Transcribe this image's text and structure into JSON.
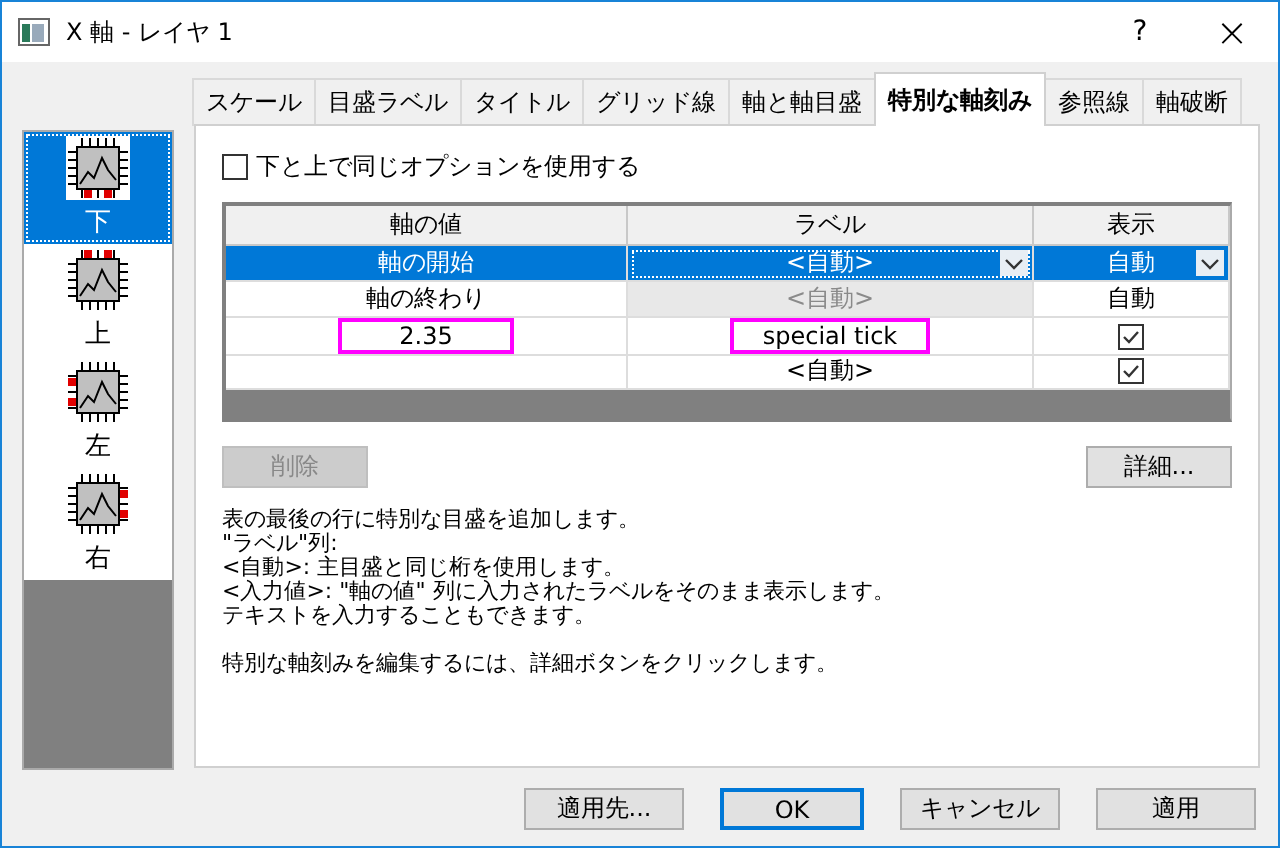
{
  "window": {
    "title": "X 軸 - レイヤ 1",
    "help": "?",
    "close": "×"
  },
  "tabs": [
    {
      "label": "スケール",
      "selected": false
    },
    {
      "label": "目盛ラベル",
      "selected": false
    },
    {
      "label": "タイトル",
      "selected": false
    },
    {
      "label": "グリッド線",
      "selected": false
    },
    {
      "label": "軸と軸目盛",
      "selected": false
    },
    {
      "label": "特別な軸刻み",
      "selected": true
    },
    {
      "label": "参照線",
      "selected": false
    },
    {
      "label": "軸破断",
      "selected": false
    }
  ],
  "sidebar": {
    "items": [
      {
        "label": "下",
        "kind": "bottom",
        "selected": true
      },
      {
        "label": "上",
        "kind": "top",
        "selected": false
      },
      {
        "label": "左",
        "kind": "left",
        "selected": false
      },
      {
        "label": "右",
        "kind": "right",
        "selected": false
      }
    ]
  },
  "same_options": {
    "label": "下と上で同じオプションを使用する",
    "checked": false
  },
  "table": {
    "columns": [
      "軸の値",
      "ラベル",
      "表示"
    ],
    "rows": [
      {
        "selected": true,
        "cells": [
          {
            "kind": "text",
            "text": "軸の開始"
          },
          {
            "kind": "dropdown",
            "text": "<自動>",
            "focused": true
          },
          {
            "kind": "dropdown",
            "text": "自動"
          }
        ]
      },
      {
        "selected": false,
        "cells": [
          {
            "kind": "text",
            "text": "軸の終わり"
          },
          {
            "kind": "text",
            "text": "<自動>",
            "disabled": true
          },
          {
            "kind": "text",
            "text": "自動"
          }
        ]
      },
      {
        "selected": false,
        "cells": [
          {
            "kind": "text",
            "text": "2.35",
            "highlighted": true
          },
          {
            "kind": "text",
            "text": "special tick",
            "highlighted": true
          },
          {
            "kind": "checkbox",
            "checked": true
          }
        ]
      },
      {
        "selected": false,
        "cells": [
          {
            "kind": "text"
          },
          {
            "kind": "text",
            "text": "<自動>"
          },
          {
            "kind": "checkbox",
            "checked": true
          }
        ]
      }
    ]
  },
  "delete_button": {
    "label": "削除",
    "disabled": true
  },
  "details_button": {
    "label": "詳細..."
  },
  "description": [
    {
      "lines": [
        "表の最後の行に特別な目盛を追加します。",
        "\"ラベル\"列:",
        "<自動>: 主目盛と同じ桁を使用します。",
        "<入力値>: \"軸の値\" 列に入力されたラベルをそのまま表示します。",
        "テキストを入力することもできます。"
      ]
    },
    {
      "lines": [
        "特別な軸刻みを編集するには、詳細ボタンをクリックします。"
      ]
    }
  ],
  "buttons": [
    {
      "label": "適用先...",
      "default": false
    },
    {
      "label": "OK",
      "default": true
    },
    {
      "label": "キャンセル",
      "default": false
    },
    {
      "label": "適用",
      "default": false
    }
  ]
}
